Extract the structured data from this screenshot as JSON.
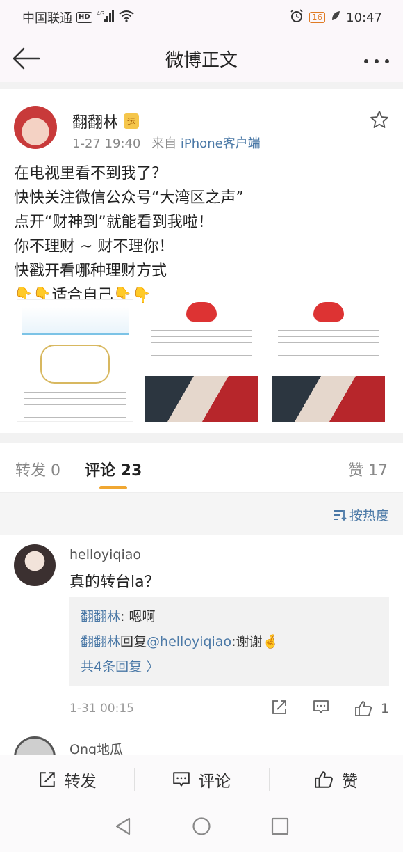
{
  "status_bar": {
    "carrier": "中国联通",
    "hd": "HD",
    "network": "4G",
    "battery": "16",
    "time": "10:47"
  },
  "nav": {
    "title": "微博正文"
  },
  "post": {
    "username": "翻翻林",
    "badge": "运",
    "time": "1-27 19:40",
    "source_prefix": "来自",
    "source": "iPhone客户端",
    "lines": [
      "在电视里看不到我了？",
      "快快关注微信公众号“大湾区之声”",
      "点开“财神到”就能看到我啦！",
      "你不理财 ~ 财不理你！",
      "快戳开看哪种理财方式",
      "👇👇适合自己👇👇"
    ]
  },
  "tabs": {
    "repost": "转发 0",
    "comments": "评论 23",
    "likes": "赞 17"
  },
  "sort": {
    "label": "按热度"
  },
  "comment": {
    "user": "helloyiqiao",
    "text": "真的转台la？",
    "replies": [
      {
        "name": "翻翻林",
        "sep": ": ",
        "text": "嗯啊"
      },
      {
        "name": "翻翻林",
        "sep": "回复",
        "mention": "@helloyiqiao",
        "text": ":谢谢🤞"
      }
    ],
    "more_replies": "共4条回复 〉",
    "time": "1-31 00:15",
    "like_count": "1"
  },
  "comment2": {
    "user": "Ong地瓜"
  },
  "bottom_bar": {
    "repost": "转发",
    "comment": "评论",
    "like": "赞"
  },
  "colors": {
    "link": "#4a78a6",
    "accent": "#f0a732"
  }
}
